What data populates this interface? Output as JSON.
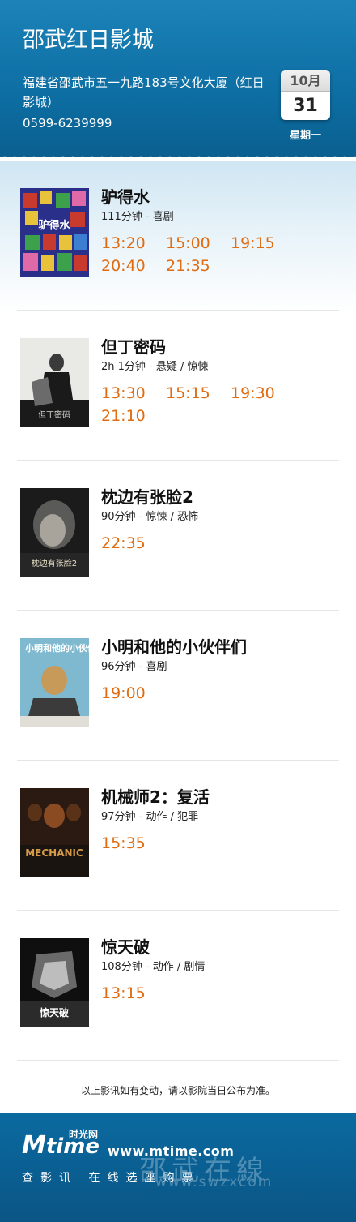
{
  "header": {
    "title": "邵武红日影城",
    "address": "福建省邵武市五一九路183号文化大厦（红日影城）",
    "phone": "0599-6239999",
    "date": {
      "month": "10月",
      "day": "31",
      "weekday": "星期一"
    }
  },
  "movies": [
    {
      "title": "驴得水",
      "info": "111分钟 - 喜剧",
      "times": [
        "13:20",
        "15:00",
        "19:15",
        "20:40",
        "21:35"
      ]
    },
    {
      "title": "但丁密码",
      "info": "2h 1分钟 - 悬疑 / 惊悚",
      "times": [
        "13:30",
        "15:15",
        "19:30",
        "21:10"
      ]
    },
    {
      "title": "枕边有张脸2",
      "info": "90分钟 - 惊悚 / 恐怖",
      "times": [
        "22:35"
      ]
    },
    {
      "title": "小明和他的小伙伴们",
      "info": "96分钟 - 喜剧",
      "times": [
        "19:00"
      ]
    },
    {
      "title": "机械师2：复活",
      "info": "97分钟 - 动作 / 犯罪",
      "times": [
        "15:35"
      ]
    },
    {
      "title": "惊天破",
      "info": "108分钟 - 动作 / 剧情",
      "times": [
        "13:15"
      ]
    }
  ],
  "posters": [
    {
      "text": "驴得水",
      "colors": [
        "#2a2f8a",
        "#c93a2e",
        "#e8c23a",
        "#3da04a"
      ]
    },
    {
      "text": "但丁密码",
      "colors": [
        "#e9e9e6",
        "#1a1a1a",
        "#6b6b6b",
        "#d8d8d4"
      ]
    },
    {
      "text": "枕边有张脸2",
      "colors": [
        "#1b1b1b",
        "#5a5a58",
        "#a8a49c",
        "#262626"
      ]
    },
    {
      "text": "小明和他的小伙伴们",
      "colors": [
        "#7fb9cf",
        "#e0ded6",
        "#3b3b3b",
        "#c89a5a"
      ]
    },
    {
      "text": "MECHANIC",
      "colors": [
        "#2a1a12",
        "#8a4a22",
        "#d49a4a",
        "#1a1410"
      ]
    },
    {
      "text": "惊天破",
      "colors": [
        "#0f0f0f",
        "#6a6a6a",
        "#bdbdbd",
        "#2b2b2b"
      ]
    }
  ],
  "notice": "以上影讯如有变动，请以影院当日公布为准。",
  "footer": {
    "logo_m": "M",
    "logo_t": "time",
    "logo_cn": "时光网",
    "site": "www.mtime.com",
    "slogan": "查影讯 在线选座购票",
    "watermark_cn": "邵武在線",
    "watermark_url": "www.swzxcom"
  }
}
